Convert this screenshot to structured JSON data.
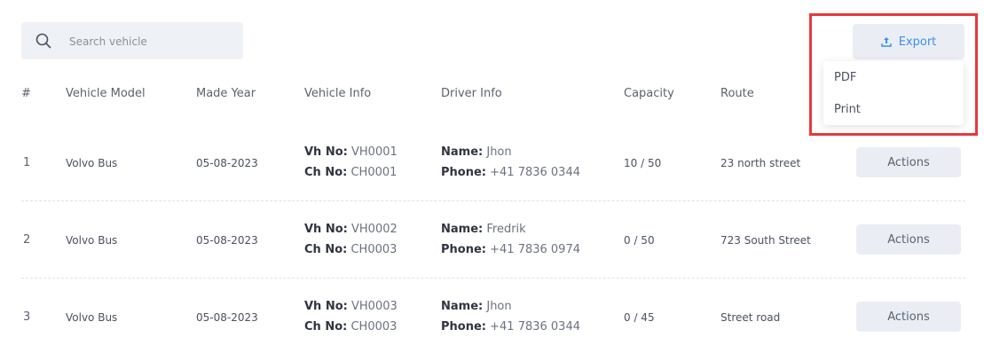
{
  "search": {
    "placeholder": "Search vehicle"
  },
  "export": {
    "label": "Export",
    "menu": [
      "PDF",
      "Print"
    ]
  },
  "table": {
    "headers": [
      "#",
      "Vehicle Model",
      "Made Year",
      "Vehicle Info",
      "Driver Info",
      "Capacity",
      "Route"
    ],
    "vh_label": "Vh No:",
    "ch_label": "Ch No:",
    "name_label": "Name:",
    "phone_label": "Phone:",
    "rows": [
      {
        "idx": "1",
        "model": "Volvo Bus",
        "year": "05-08-2023",
        "vh": "VH0001",
        "ch": "CH0001",
        "name": "Jhon",
        "phone": "+41 7836 0344",
        "capacity": "10 / 50",
        "route": "23 north street",
        "action": "Actions"
      },
      {
        "idx": "2",
        "model": "Volvo Bus",
        "year": "05-08-2023",
        "vh": "VH0002",
        "ch": "CH0003",
        "name": "Fredrik",
        "phone": "+41 7836 0974",
        "capacity": "0 / 50",
        "route": "723 South Street",
        "action": "Actions"
      },
      {
        "idx": "3",
        "model": "Volvo Bus",
        "year": "05-08-2023",
        "vh": "VH0003",
        "ch": "CH0003",
        "name": "Jhon",
        "phone": "+41 7836 0344",
        "capacity": "0 / 45",
        "route": "Street road",
        "action": "Actions"
      }
    ]
  },
  "colors": {
    "accent": "#3b8ff0",
    "highlight": "#e8383d",
    "surface": "#eef1f5"
  }
}
